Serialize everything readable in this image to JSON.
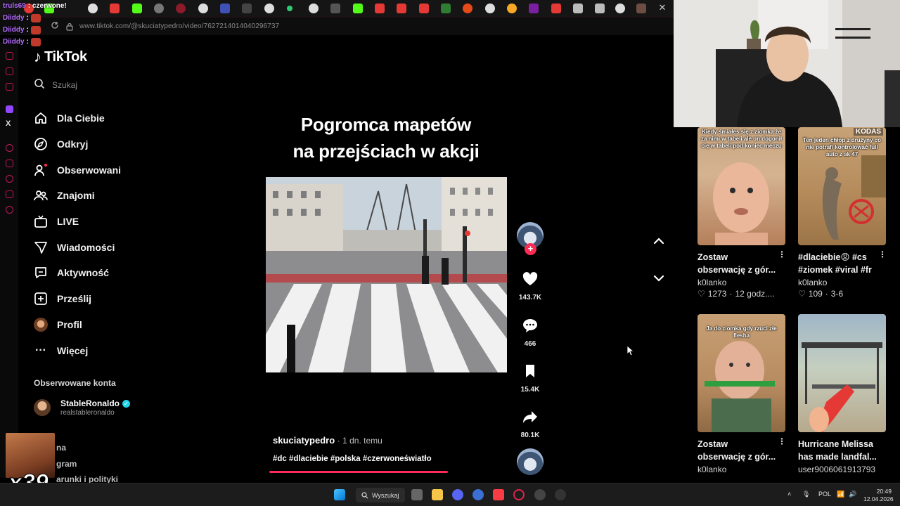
{
  "browser": {
    "url": "www.tiktok.com/@skuciatypedro/video/7627214014040296737",
    "tab_close": "✕"
  },
  "chat": [
    {
      "name": "truls69",
      "message": ": czerwone!"
    },
    {
      "name": "Diiddy",
      "message": ":"
    },
    {
      "name": "Diiddy",
      "message": ":"
    },
    {
      "name": "Diiddy",
      "message": ":"
    }
  ],
  "sidebar": {
    "logo": "TikTok",
    "search_placeholder": "Szukaj",
    "items": [
      {
        "label": "Dla Ciebie",
        "icon": "home-icon"
      },
      {
        "label": "Odkryj",
        "icon": "compass-icon"
      },
      {
        "label": "Obserwowani",
        "icon": "following-icon"
      },
      {
        "label": "Znajomi",
        "icon": "friends-icon"
      },
      {
        "label": "LIVE",
        "icon": "live-icon"
      },
      {
        "label": "Wiadomości",
        "icon": "messages-icon"
      },
      {
        "label": "Aktywność",
        "icon": "activity-icon"
      },
      {
        "label": "Prześlij",
        "icon": "upload-icon"
      },
      {
        "label": "Profil",
        "icon": "profile-icon"
      },
      {
        "label": "Więcej",
        "icon": "more-icon"
      }
    ],
    "followed_title": "Obserwowane konta",
    "followed_account": {
      "name": "StableRonaldo",
      "handle": "realstableronaldo"
    },
    "partial_rows": [
      "na",
      "gram",
      "arunki i polityki"
    ]
  },
  "overlay": {
    "multiplier": "x39"
  },
  "video": {
    "title_line1": "Pogromca mapetów",
    "title_line2": "na przejściach w akcji",
    "author": "skuciatypedro",
    "posted": "· 1 dn. temu",
    "tags": "#dc #dlaciebie #polska #czerwoneświatło",
    "progress_fraction": 0.68,
    "actions": {
      "likes": "143.7K",
      "comments": "466",
      "saves": "15.4K",
      "shares": "80.1K"
    }
  },
  "recommendations": [
    {
      "thumb_text": "Kiedy śmiałeś się z ziomka że za nimi w tabeli ale on dogonił cię w tabeli pod koniec meczu",
      "title_line1": "Zostaw",
      "title_line2": "obserwację z gór...",
      "user": "k0lanko",
      "likes": "1273",
      "time": "12 godz...."
    },
    {
      "thumb_text": "Ten jeden chłop z drużyny co nie potrafi kontrolować full auto z ak 47",
      "badge": "KODAS",
      "title_line1": "#dlaciebie😡 #cs",
      "title_line2": "#ziomek #viral #fr",
      "user": "k0lanko",
      "likes": "109",
      "time": "3-6"
    },
    {
      "thumb_text": "Ja do ziomka gdy rzuci złe flesha",
      "title_line1": "Zostaw",
      "title_line2": "obserwację z gór...",
      "user": "k0lanko"
    },
    {
      "thumb_text": "",
      "title_line1": "Hurricane Melissa",
      "title_line2": "has made landfal...",
      "user": "user9006061913793"
    }
  ],
  "taskbar": {
    "search": "Wyszukaj",
    "lang": "POL",
    "time": "20:49",
    "date": "12.04.2026"
  },
  "colors": {
    "accent": "#fe2c55",
    "background": "#000000",
    "chat_name": "#b46cff"
  }
}
